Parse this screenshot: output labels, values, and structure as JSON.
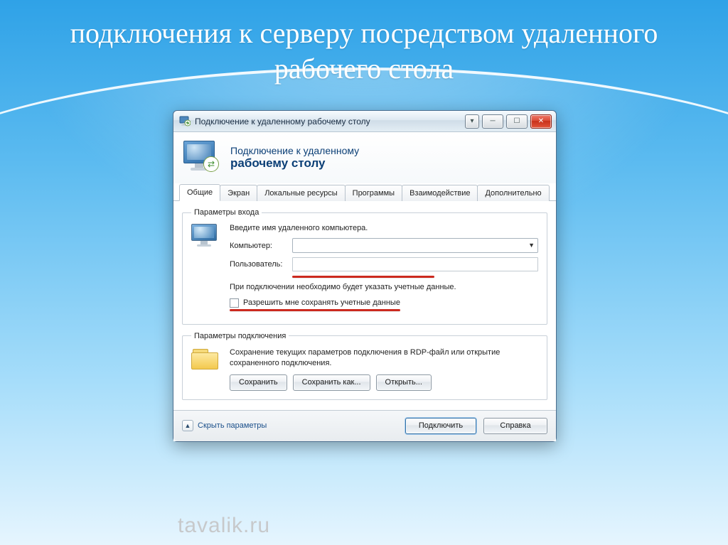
{
  "slide": {
    "title": "подключения к серверу посредством удаленного рабочего стола"
  },
  "window": {
    "title": "Подключение к удаленному рабочему столу",
    "header_line1": "Подключение к удаленному",
    "header_line2": "рабочему столу"
  },
  "tabs": [
    {
      "label": "Общие",
      "active": true
    },
    {
      "label": "Экран",
      "active": false
    },
    {
      "label": "Локальные ресурсы",
      "active": false
    },
    {
      "label": "Программы",
      "active": false
    },
    {
      "label": "Взаимодействие",
      "active": false
    },
    {
      "label": "Дополнительно",
      "active": false
    }
  ],
  "login_group": {
    "legend": "Параметры входа",
    "intro": "Введите имя удаленного компьютера.",
    "computer_label": "Компьютер:",
    "computer_value": "",
    "user_label": "Пользователь:",
    "user_value": "",
    "hint": "При подключении необходимо будет указать учетные данные.",
    "checkbox_label": "Разрешить мне сохранять учетные данные"
  },
  "conn_group": {
    "legend": "Параметры подключения",
    "desc": "Сохранение текущих параметров подключения в RDP-файл или открытие сохраненного подключения.",
    "save": "Сохранить",
    "save_as": "Сохранить как...",
    "open": "Открыть..."
  },
  "footer": {
    "hide_params": "Скрыть параметры",
    "connect": "Подключить",
    "help": "Справка"
  },
  "watermark": "tavalik.ru"
}
